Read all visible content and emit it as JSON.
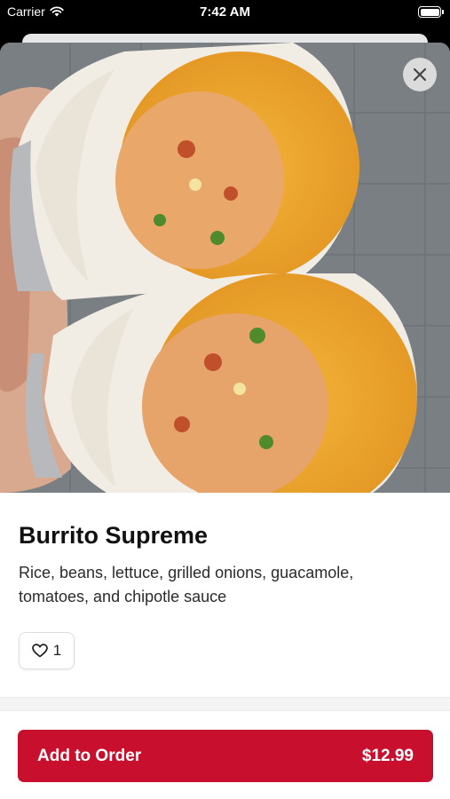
{
  "status_bar": {
    "carrier": "Carrier",
    "time": "7:42 AM"
  },
  "item": {
    "title": "Burrito Supreme",
    "description": "Rice, beans, lettuce, grilled onions, guacamole, tomatoes, and chipotle sauce",
    "like_count": "1",
    "image_icon": "burrito-photo"
  },
  "order": {
    "label": "Add to Order",
    "price": "$12.99"
  },
  "colors": {
    "accent": "#c8102e",
    "background": "#ffffff",
    "text": "#111111"
  }
}
